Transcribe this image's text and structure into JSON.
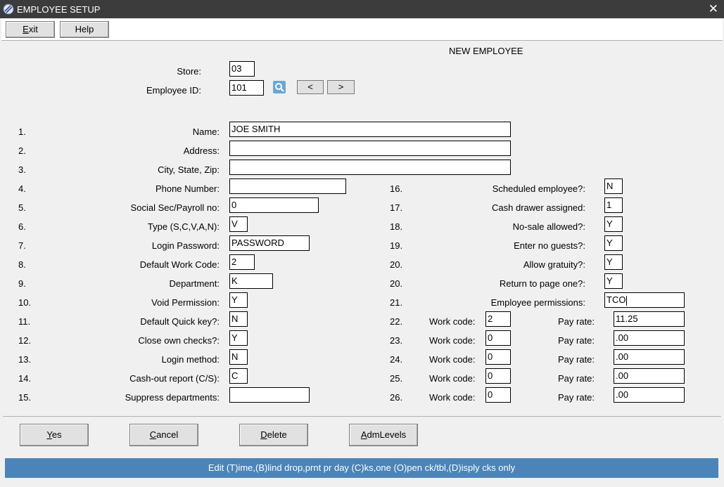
{
  "window": {
    "title": "EMPLOYEE SETUP",
    "close_glyph": "✕"
  },
  "toolbar": {
    "exit": "Exit",
    "exit_ul": "E",
    "exit_rest": "xit",
    "help": "Help"
  },
  "header": {
    "new_employee": "NEW EMPLOYEE"
  },
  "store": {
    "label": "Store:",
    "value": "03"
  },
  "employee_id": {
    "label": "Employee ID:",
    "value": "101",
    "prev": "<",
    "next": ">"
  },
  "left_fields": [
    {
      "num": "1.",
      "label": "Name:",
      "value": "JOE SMITH"
    },
    {
      "num": "2.",
      "label": "Address:",
      "value": ""
    },
    {
      "num": "3.",
      "label": "City, State, Zip:",
      "value": ""
    },
    {
      "num": "4.",
      "label": "Phone Number:",
      "value": ""
    },
    {
      "num": "5.",
      "label": "Social Sec/Payroll no:",
      "value": "0"
    },
    {
      "num": "6.",
      "label": "Type (S,C,V,A,N):",
      "value": "V"
    },
    {
      "num": "7.",
      "label": "Login Password:",
      "value": "PASSWORD"
    },
    {
      "num": "8.",
      "label": "Default Work Code:",
      "value": "2"
    },
    {
      "num": "9.",
      "label": "Department:",
      "value": "K"
    },
    {
      "num": "10.",
      "label": "Void Permission:",
      "value": "Y"
    },
    {
      "num": "11.",
      "label": "Default Quick key?:",
      "value": "N"
    },
    {
      "num": "12.",
      "label": "Close own checks?:",
      "value": "Y"
    },
    {
      "num": "13.",
      "label": "Login method:",
      "value": "N"
    },
    {
      "num": "14.",
      "label": "Cash-out report (C/S):",
      "value": "C"
    },
    {
      "num": "15.",
      "label": "Suppress departments:",
      "value": ""
    }
  ],
  "right_fields": [
    {
      "num": "16.",
      "label": "Scheduled employee?:",
      "value": "N"
    },
    {
      "num": "17.",
      "label": "Cash drawer assigned:",
      "value": "1"
    },
    {
      "num": "18.",
      "label": "No-sale allowed?:",
      "value": "Y"
    },
    {
      "num": "19.",
      "label": "Enter no  guests?:",
      "value": "Y"
    },
    {
      "num": "20.",
      "label": "Allow gratuity?:",
      "value": "Y"
    },
    {
      "num": "20.",
      "label": "Return to page one?:",
      "value": "Y"
    },
    {
      "num": "21.",
      "label": "Employee permissions:",
      "value": "TCO"
    }
  ],
  "work_codes": [
    {
      "num": "22.",
      "label": "Work code:",
      "code": "2",
      "pay_label": "Pay rate:",
      "pay": "11.25"
    },
    {
      "num": "23.",
      "label": "Work code:",
      "code": "0",
      "pay_label": "Pay rate:",
      "pay": ".00"
    },
    {
      "num": "24.",
      "label": "Work code:",
      "code": "0",
      "pay_label": "Pay rate:",
      "pay": ".00"
    },
    {
      "num": "25.",
      "label": "Work code:",
      "code": "0",
      "pay_label": "Pay rate:",
      "pay": ".00"
    },
    {
      "num": "26.",
      "label": "Work code:",
      "code": "0",
      "pay_label": "Pay rate:",
      "pay": ".00"
    }
  ],
  "buttons": {
    "yes": "Yes",
    "yes_ul": "Y",
    "yes_rest": "es",
    "cancel": "Cancel",
    "cancel_ul": "C",
    "cancel_rest": "ancel",
    "delete": "Delete",
    "delete_ul": "D",
    "delete_rest": "elete",
    "admlevels": "AdmLevels",
    "admlevels_ul": "A",
    "admlevels_rest": "dmLevels"
  },
  "status": {
    "text": "Edit (T)ime,(B)lind drop,prnt pr day (C)ks,one (O)pen ck/tbl,(D)isply cks only"
  },
  "colors": {
    "titlebar": "#3c3c3c",
    "status_bar": "#4a84b8",
    "window_bg": "#f0f0f0"
  },
  "icons": {
    "app": "app-icon",
    "search": "search-icon",
    "close": "close-icon"
  }
}
